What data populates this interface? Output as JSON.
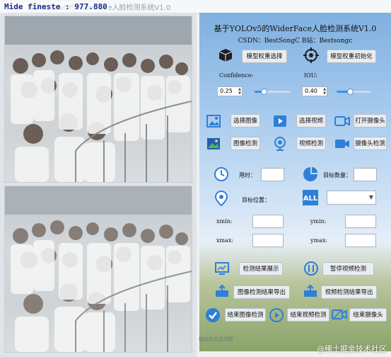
{
  "window": {
    "title": "基于YOLOv5的WiderFace人脸检测系统V1.0",
    "fps_text": "Mide fineste : 977.880"
  },
  "header": {
    "title": "基于YOLOv5的WiderFace人脸检测系统V1.0",
    "credit": "CSDN：BestSongC   B站：Bestsongc"
  },
  "model": {
    "select_label": "模型权重选择",
    "init_label": "模型权重初始化"
  },
  "params": {
    "confidence_label": "Confidence:",
    "confidence_value": "0.25",
    "confidence_level": 0.25,
    "iou_label": "IOU:",
    "iou_value": "0.40",
    "iou_level": 0.4
  },
  "actions": {
    "select_image": "选择图像",
    "select_video": "选择视频",
    "open_camera": "打开摄像头",
    "detect_image": "图像检测",
    "detect_video": "视频检测",
    "detect_camera": "摄像头检测"
  },
  "results": {
    "time_label": "用时：",
    "count_label": "目标数量：",
    "position_label": "目标位置：",
    "xmin_label": "xmin:",
    "ymin_label": "ymin:",
    "xmax_label": "xmax:",
    "ymax_label": "ymax:"
  },
  "controls": {
    "show_result": "检测结果展示",
    "pause_video": "暂停视频检测",
    "export_image": "图像检测结果导出",
    "export_video": "视频检测结果导出",
    "end_image": "结束图像检测",
    "end_video": "结束视频检测",
    "end_camera": "结束摄像头"
  },
  "status": {
    "text": "输出状态监测框"
  },
  "watermark": "@稀土掘金技术社区",
  "icons": [
    "cube-icon",
    "target-icon",
    "image-icon",
    "video-play-icon",
    "camera-icon",
    "image-detect-icon",
    "webcam-icon",
    "video-camera-icon",
    "clock-icon",
    "pie-chart-icon",
    "location-pin-icon",
    "all-icon",
    "result-screen-icon",
    "pause-icon",
    "export-image-icon",
    "export-video-icon",
    "check-circle-icon",
    "stop-circle-icon",
    "end-camera-icon"
  ],
  "colors": {
    "accent": "#2f7fd8",
    "button_bg": "#e9edf1"
  }
}
